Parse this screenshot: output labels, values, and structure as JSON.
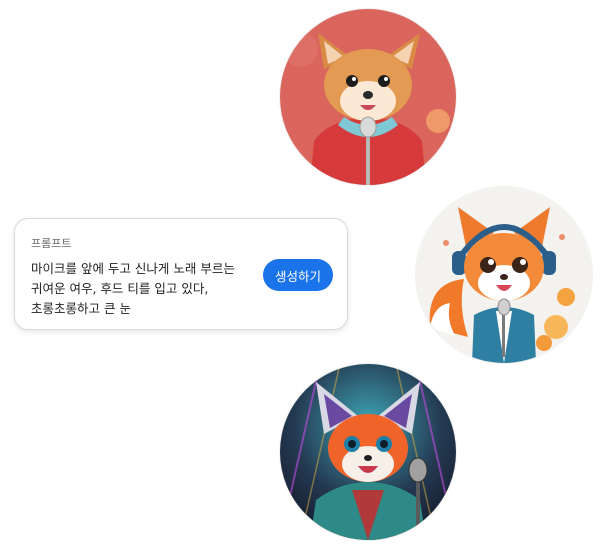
{
  "prompt_card": {
    "label": "프롬프트",
    "lines": [
      "마이크를 앞에 두고 신나게 노래 부르는",
      "귀여운 여우, 후드 티를 입고 있다,",
      "초롱초롱하고 큰 눈"
    ],
    "generate_label": "생성하기"
  },
  "images": [
    {
      "background": "#d9655c",
      "style": "3d-render-fox"
    },
    {
      "background": "#f4f2ee",
      "style": "cartoon-fox-headphones"
    },
    {
      "background": "#1b2b3a",
      "style": "neon-fox"
    }
  ],
  "colors": {
    "button": "#1a73e8"
  }
}
